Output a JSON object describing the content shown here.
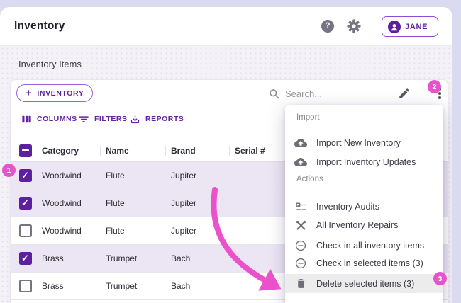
{
  "header": {
    "title": "Inventory",
    "help_label": "?",
    "user_name": "JANE"
  },
  "section": {
    "title": "Inventory Items"
  },
  "toolbar": {
    "plus": "+",
    "add_label": "INVENTORY",
    "search_placeholder": "Search...",
    "columns_label": "COLUMNS",
    "filters_label": "FILTERS",
    "reports_label": "REPORTS"
  },
  "table": {
    "columns": [
      "Category",
      "Name",
      "Brand",
      "Serial #"
    ],
    "header_checkbox_state": "indeterminate",
    "rows": [
      {
        "category": "Woodwind",
        "name": "Flute",
        "brand": "Jupiter",
        "serial": "",
        "checked": true,
        "highlighted": true
      },
      {
        "category": "Woodwind",
        "name": "Flute",
        "brand": "Jupiter",
        "serial": "",
        "checked": true,
        "highlighted": true
      },
      {
        "category": "Woodwind",
        "name": "Flute",
        "brand": "Jupiter",
        "serial": "",
        "checked": false,
        "highlighted": false
      },
      {
        "category": "Brass",
        "name": "Trumpet",
        "brand": "Bach",
        "serial": "",
        "checked": true,
        "highlighted": true
      },
      {
        "category": "Brass",
        "name": "Trumpet",
        "brand": "Bach",
        "serial": "",
        "checked": false,
        "highlighted": false
      }
    ]
  },
  "menu": {
    "sections": [
      {
        "label": "Import",
        "items": [
          {
            "icon": "cloud-upload-icon",
            "label": "Import New Inventory"
          },
          {
            "icon": "cloud-upload-icon",
            "label": "Import Inventory Updates"
          }
        ]
      },
      {
        "label": "Actions",
        "items": [
          {
            "icon": "checklist-icon",
            "label": "Inventory Audits"
          },
          {
            "icon": "crossed-tools-icon",
            "label": "All Inventory Repairs"
          },
          {
            "icon": "circle-minus-icon",
            "label": "Check in all inventory items"
          },
          {
            "icon": "circle-minus-icon",
            "label": "Check in selected items (3)"
          },
          {
            "icon": "trash-icon",
            "label": "Delete selected items (3)",
            "highlighted": true
          }
        ]
      }
    ]
  },
  "annotations": {
    "badge1": "1",
    "badge2": "2",
    "badge3": "3"
  },
  "colors": {
    "accent_purple": "#5d1f9d",
    "accent_text": "#5e22a0",
    "annotation_pink": "#e952cb",
    "row_highlight": "#ece6f4",
    "menu_item_highlight": "#ececec",
    "page_background": "#dadaf0"
  }
}
